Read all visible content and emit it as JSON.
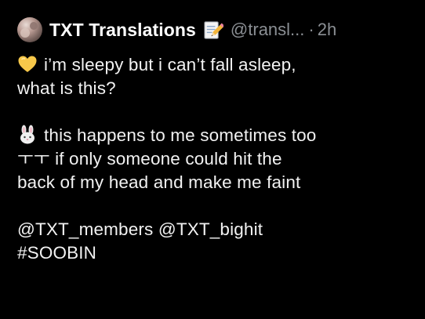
{
  "tweet": {
    "display_name": "TXT Translations",
    "handle": "@transl...",
    "separator": "·",
    "time": "2h",
    "badge_icon": "memo-pencil-icon",
    "paragraph1": {
      "emoji": "yellow-heart-icon",
      "line1": "i’m sleepy but i can’t fall asleep,",
      "line2": "what is this?"
    },
    "paragraph2": {
      "emoji": "rabbit-face-icon",
      "line1": "this happens to me sometimes too",
      "line2": "ㅜㅜ if only someone could hit the",
      "line3": "back of my head and make me faint"
    },
    "paragraph3": {
      "mention1": "@TXT_members",
      "mention2": "@TXT_bighit",
      "hashtag": "#SOOBIN"
    }
  },
  "colors": {
    "background": "#000000",
    "text": "#f2f2f2",
    "secondary": "#8b8f94",
    "heart": "#f7c84a"
  }
}
